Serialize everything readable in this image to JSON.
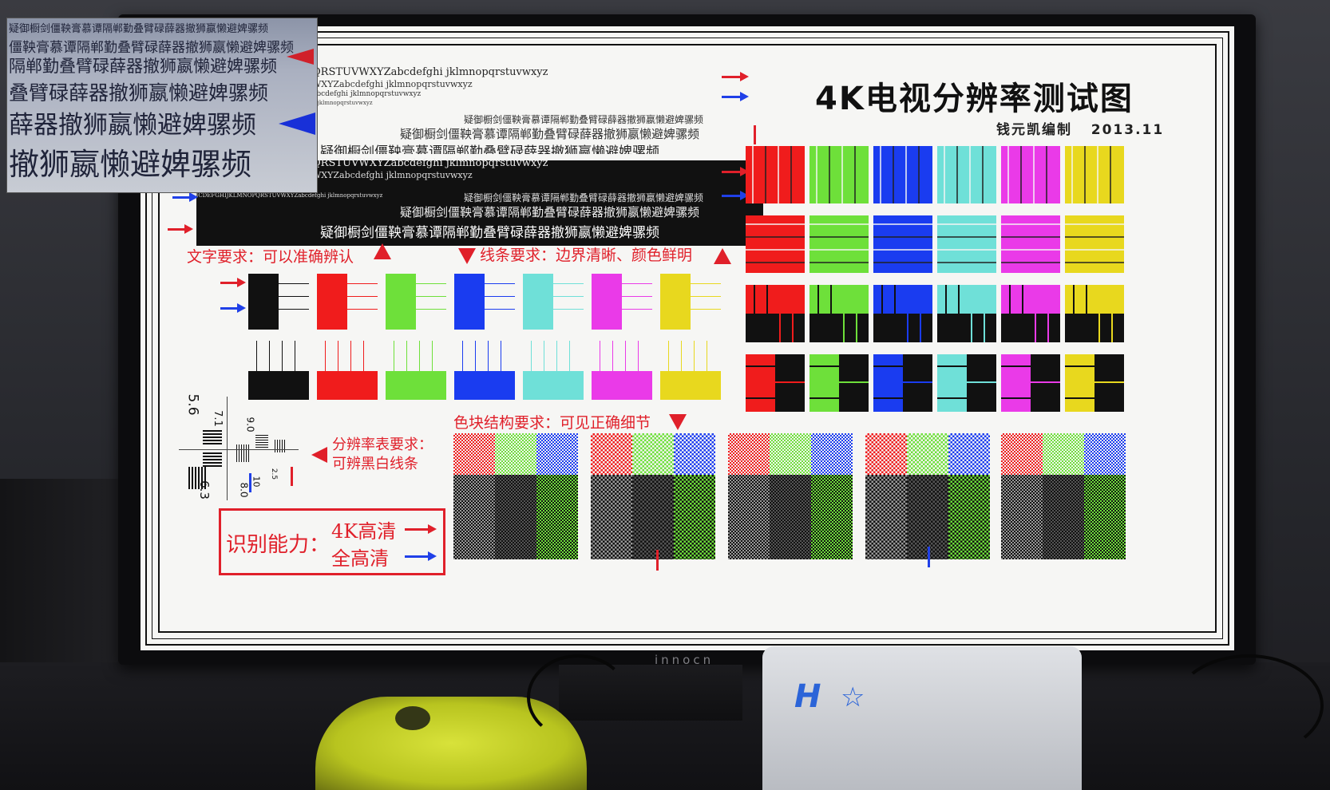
{
  "chart": {
    "title": "4K电视分辨率测试图",
    "author": "钱元凯编制",
    "date": "2013.11"
  },
  "text_lines_light": [
    "QRSTUVWXYZabcdefghi jklmnopqrstuvwxyz",
    "WXYZabcdefghi jklmnopqrstuvwxyz",
    "abcdefghi jklmnopqrstuvwxyz",
    "hijklmnopqrstuvwxyz",
    "疑御橱剑僵鞅膏慕谭隔郸勤叠臂碌薛器撤狮嬴懒避婢骡频",
    "疑御橱剑僵鞅膏慕谭隔郸勤叠臂碌薛器撤狮嬴懒避婢骡频",
    "疑御橱剑僵鞅膏慕谭隔郸勤叠臂碌薛器撤狮嬴懒避婢骡频"
  ],
  "text_lines_dark": [
    "QRSTUVWXYZabcdefghi jklmnopqrstuvwxyz",
    "WXYZabcdefghi jklmnopqrstuvwxyz",
    "ABCDEFGHIJKLMNOPQRSTUVWXYZabcdefghi jklmnopqrstuvwxyz",
    "疑御橱剑僵鞅膏慕谭隔郸勤叠臂碌薛器撤狮嬴懒避婢骡频",
    "疑御橱剑僵鞅膏慕谭隔郸勤叠臂碌薛器撤狮嬴懒避婢骡频",
    "疑御橱剑僵鞅膏慕谭隔郸勤叠臂碌薛器撤狮嬴懒避婢骡频"
  ],
  "labels": {
    "text_requirement": "文字要求：可以准确辨认",
    "line_requirement": "线条要求：边界清晰、颜色鲜明",
    "color_block_requirement": "色块结构要求：可见正确细节",
    "resolution_requirement_1": "分辨率表要求：",
    "resolution_requirement_2": "可辨黑白线条",
    "recognition": "识别能力：",
    "uhd": "4K高清",
    "fhd": "全高清"
  },
  "resolution_numbers": {
    "a": "5.6",
    "b": "7.1",
    "c": "6.3",
    "d": "9.0",
    "e": "8.0",
    "f": "10",
    "g": "2.5"
  },
  "monitor_brand": "innocn",
  "inset_lines": [
    "疑御橱剑僵鞅膏慕谭隔郸勤叠臂碌薛器撤狮嬴懒避婢骡频",
    "僵鞅膏慕谭隔郸勤叠臂碌薛器撤狮嬴懒避婢骡频",
    "隔郸勤叠臂碌薛器撤狮嬴懒避婢骡频",
    "叠臂碌薛器撤狮嬴懒避婢骡频",
    "薛器撤狮嬴懒避婢骡频",
    "撤狮嬴懒避婢骡频"
  ],
  "box_logo": "H",
  "colors": {
    "red": "#f01c1c",
    "green": "#6ee03a",
    "blue": "#1a3cf0",
    "cyan": "#6fe0d8",
    "magenta": "#ea3ae8",
    "yellow": "#e8d81e",
    "black": "#111111",
    "accent_red": "#e0202a",
    "accent_blue": "#2040e8"
  }
}
